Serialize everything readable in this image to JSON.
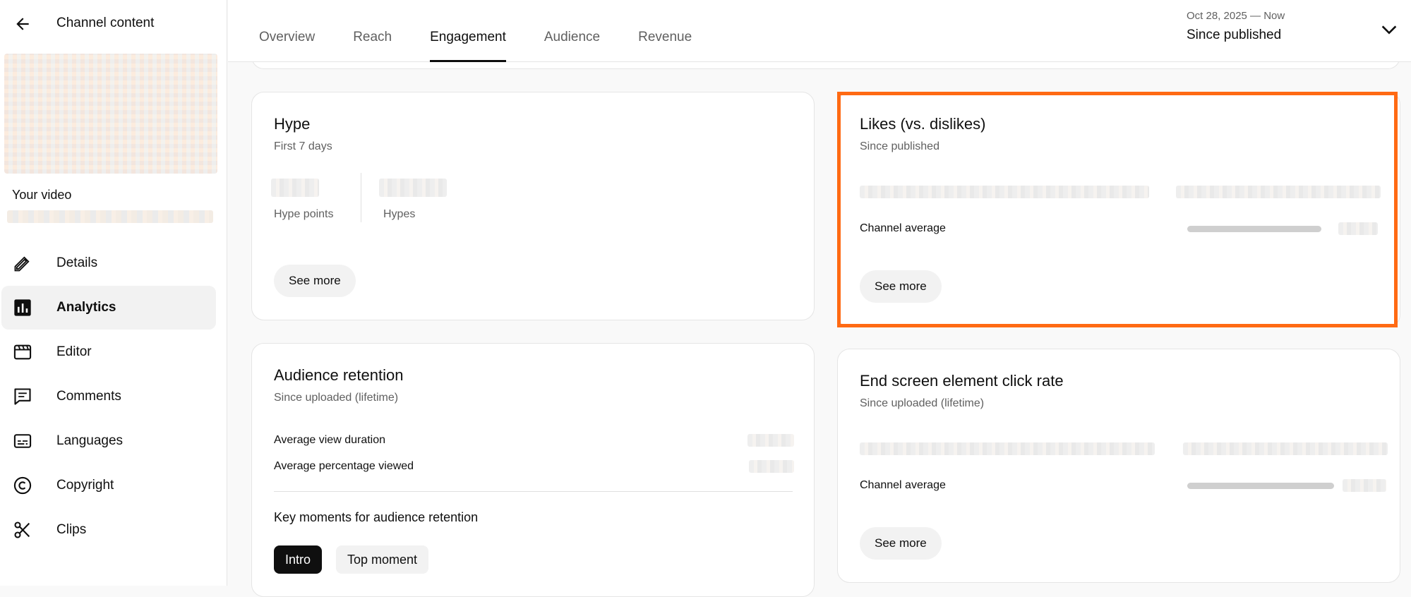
{
  "sidebar": {
    "title": "Channel content",
    "your_video": "Your video",
    "items": [
      {
        "label": "Details",
        "icon": "pencil-icon",
        "active": false
      },
      {
        "label": "Analytics",
        "icon": "analytics-icon",
        "active": true
      },
      {
        "label": "Editor",
        "icon": "clapperboard-icon",
        "active": false
      },
      {
        "label": "Comments",
        "icon": "comment-icon",
        "active": false
      },
      {
        "label": "Languages",
        "icon": "subtitles-icon",
        "active": false
      },
      {
        "label": "Copyright",
        "icon": "copyright-icon",
        "active": false
      },
      {
        "label": "Clips",
        "icon": "scissors-icon",
        "active": false
      }
    ]
  },
  "tabs": [
    "Overview",
    "Reach",
    "Engagement",
    "Audience",
    "Revenue"
  ],
  "active_tab": "Engagement",
  "date_range": {
    "range": "Oct 28, 2025 — Now",
    "label": "Since published"
  },
  "cards": {
    "hype": {
      "title": "Hype",
      "subtitle": "First 7 days",
      "metric1_label": "Hype points",
      "metric2_label": "Hypes",
      "see_more": "See more"
    },
    "likes": {
      "title": "Likes (vs. dislikes)",
      "subtitle": "Since published",
      "channel_average_label": "Channel average",
      "see_more": "See more"
    },
    "retention": {
      "title": "Audience retention",
      "subtitle": "Since uploaded (lifetime)",
      "row1_label": "Average view duration",
      "row2_label": "Average percentage viewed",
      "key_moments_title": "Key moments for audience retention",
      "chip_intro": "Intro",
      "chip_top": "Top moment"
    },
    "end_screen": {
      "title": "End screen element click rate",
      "subtitle": "Since uploaded (lifetime)",
      "channel_average_label": "Channel average",
      "see_more": "See more"
    }
  },
  "colors": {
    "highlight": "#ff6a13",
    "accent": "#0f0f0f"
  }
}
